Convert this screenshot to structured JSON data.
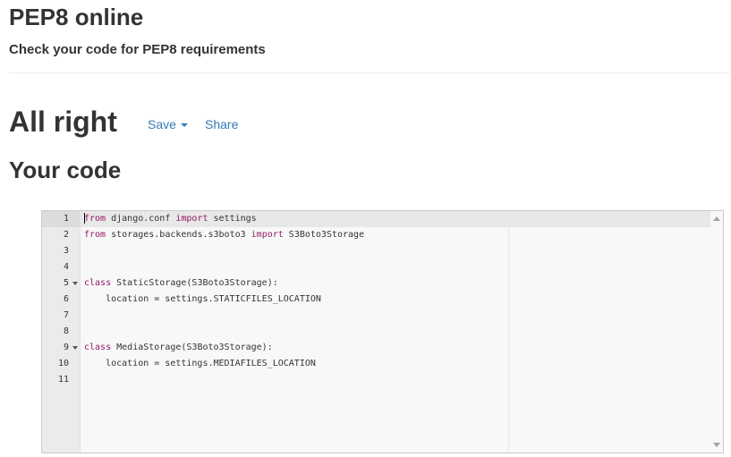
{
  "header": {
    "title": "PEP8 online",
    "subtitle": "Check your code for PEP8 requirements"
  },
  "result": {
    "title": "All right",
    "save_label": "Save",
    "share_label": "Share"
  },
  "code_section": {
    "title": "Your code"
  },
  "editor": {
    "active_line": 1,
    "lines": [
      {
        "number": "1",
        "tokens": [
          {
            "t": "from",
            "k": "kw"
          },
          {
            "t": " django.conf ",
            "k": ""
          },
          {
            "t": "import",
            "k": "kw"
          },
          {
            "t": " settings",
            "k": ""
          }
        ],
        "fold": false
      },
      {
        "number": "2",
        "tokens": [
          {
            "t": "from",
            "k": "kw"
          },
          {
            "t": " storages.backends.s3boto3 ",
            "k": ""
          },
          {
            "t": "import",
            "k": "kw"
          },
          {
            "t": " S3Boto3Storage",
            "k": ""
          }
        ],
        "fold": false
      },
      {
        "number": "3",
        "tokens": [],
        "fold": false
      },
      {
        "number": "4",
        "tokens": [],
        "fold": false
      },
      {
        "number": "5",
        "tokens": [
          {
            "t": "class",
            "k": "cls"
          },
          {
            "t": " StaticStorage(S3Boto3Storage):",
            "k": ""
          }
        ],
        "fold": true
      },
      {
        "number": "6",
        "tokens": [
          {
            "t": "    location = settings.STATICFILES_LOCATION",
            "k": ""
          }
        ],
        "fold": false
      },
      {
        "number": "7",
        "tokens": [],
        "fold": false
      },
      {
        "number": "8",
        "tokens": [],
        "fold": false
      },
      {
        "number": "9",
        "tokens": [
          {
            "t": "class",
            "k": "cls"
          },
          {
            "t": " MediaStorage(S3Boto3Storage):",
            "k": ""
          }
        ],
        "fold": true
      },
      {
        "number": "10",
        "tokens": [
          {
            "t": "    location = settings.MEDIAFILES_LOCATION",
            "k": ""
          }
        ],
        "fold": false
      },
      {
        "number": "11",
        "tokens": [],
        "fold": false
      }
    ]
  },
  "colors": {
    "link": "#337ab7",
    "keyword": "#931a68",
    "text": "#333333"
  }
}
